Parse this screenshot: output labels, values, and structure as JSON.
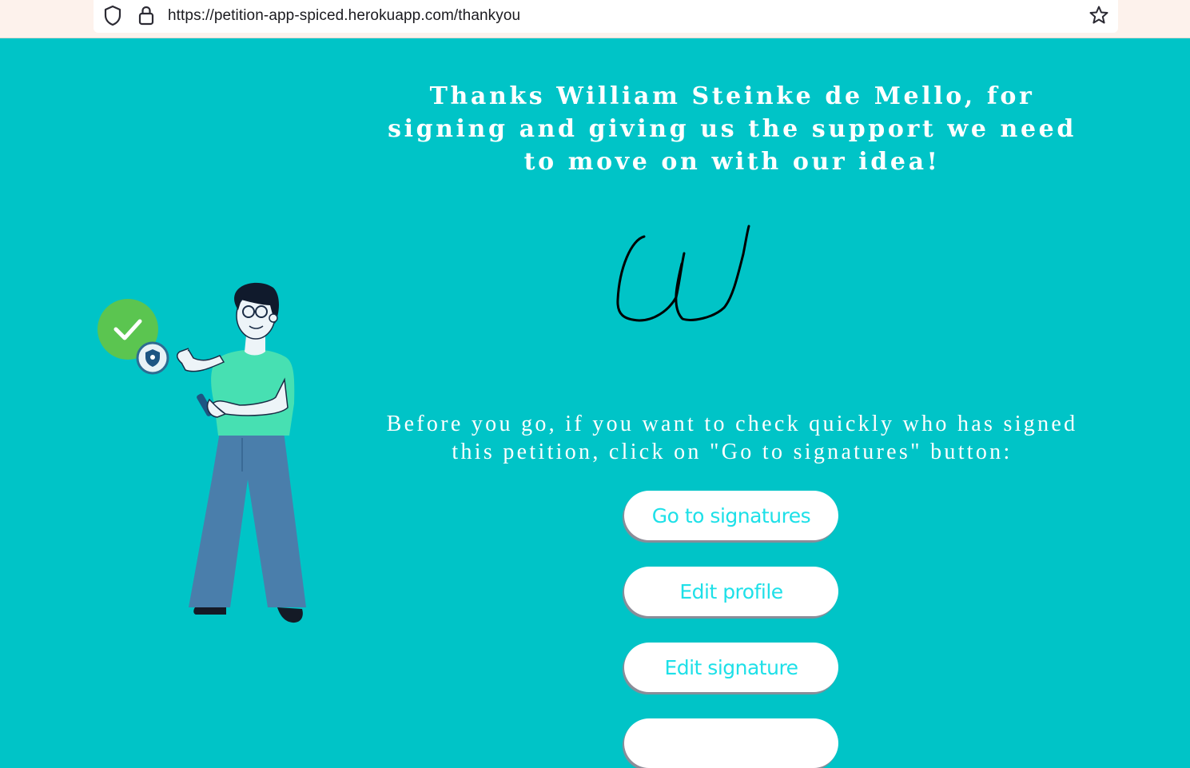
{
  "browser": {
    "url": "https://petition-app-spiced.herokuapp.com/thankyou"
  },
  "page": {
    "title": "Thanks William Steinke de Mello, for signing and giving us the support we need to move on with our idea!",
    "info": "Before you go, if you want to check quickly who has signed this petition, click on \"Go to signatures\" button:",
    "buttons": {
      "signatures": "Go to signatures",
      "edit_profile": "Edit profile",
      "edit_signature": "Edit signature"
    }
  },
  "icons": {
    "address_bar": [
      "shield-icon",
      "lock-icon",
      "star-icon"
    ],
    "illustration": [
      "check-circle-icon",
      "security-shield-icon"
    ]
  },
  "colors": {
    "background": "#00c4c7",
    "button_text": "#1ee0e8",
    "check_badge": "#5bc550",
    "shirt": "#47e0b2",
    "pants": "#4a7eab"
  }
}
